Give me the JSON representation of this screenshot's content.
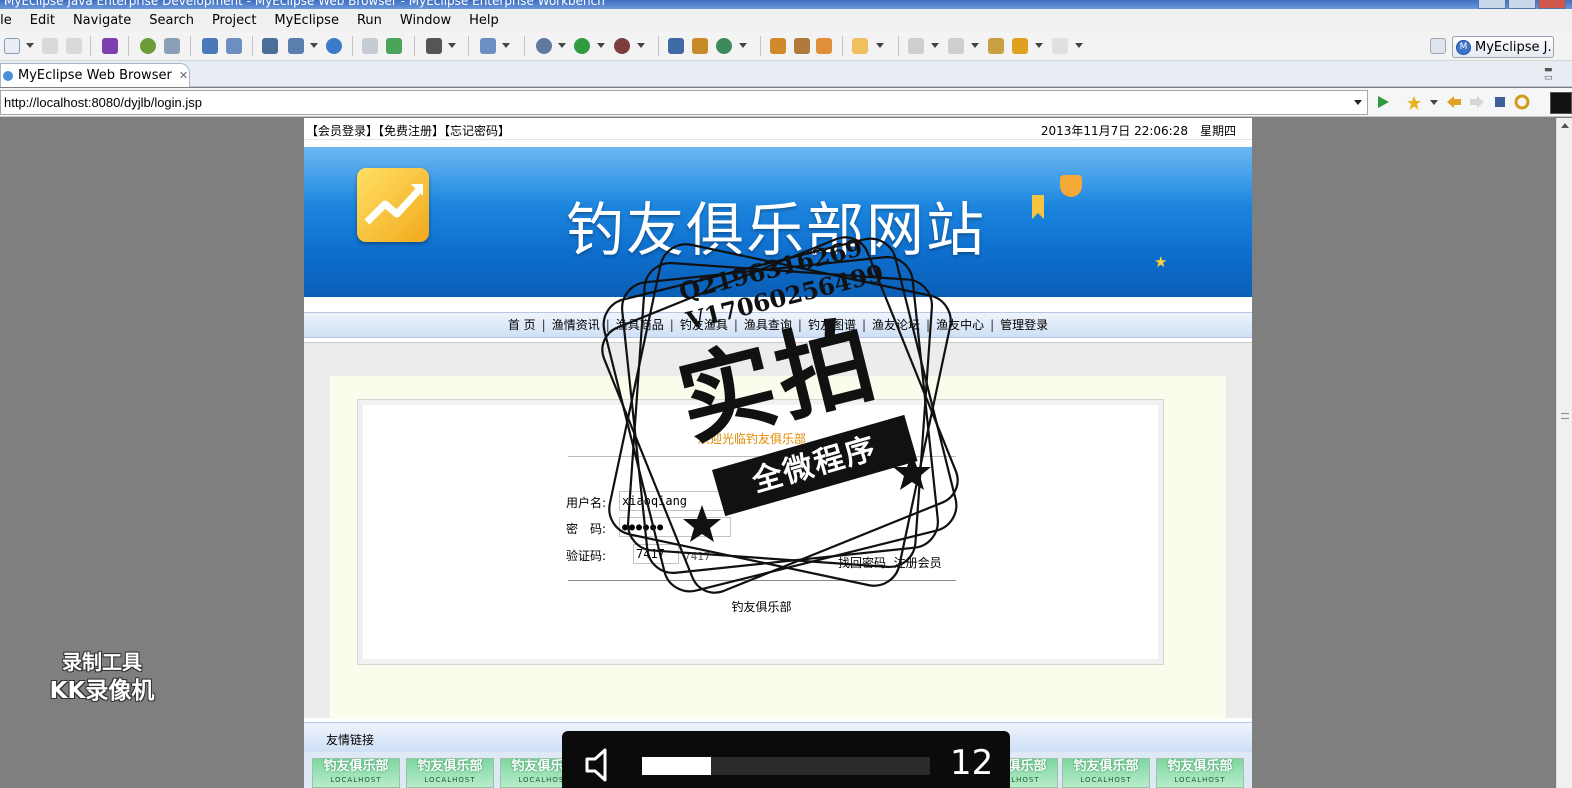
{
  "window": {
    "title": "MyEclipse Java Enterprise Development - MyEclipse Web Browser - MyEclipse Enterprise Workbench"
  },
  "menu": [
    "File",
    "Edit",
    "Navigate",
    "Search",
    "Project",
    "MyEclipse",
    "Run",
    "Window",
    "Help"
  ],
  "perspective": {
    "label": "MyEclipse J..."
  },
  "editor_tab": {
    "label": "MyEclipse Web Browser",
    "close": "✕"
  },
  "browser": {
    "url": "http://localhost:8080/dyjlb/login.jsp"
  },
  "site": {
    "top_links": [
      "【会员登录】",
      "【免费注册】",
      "【忘记密码】"
    ],
    "datetime": "2013年11月7日 22:06:28　星期四",
    "title": "钓友俱乐部网站",
    "nav": [
      "首 页",
      "渔情资讯",
      "渔具商品",
      "钓友渔具",
      "渔具查询",
      "钓友图谱",
      "渔友论坛",
      "渔友中心",
      "管理登录"
    ],
    "login": {
      "title": "欢迎光临钓友俱乐部",
      "username_label": "用户名:",
      "username_value": "xiaoqiang",
      "password_label": "密　码:",
      "password_value": "●●●●●●",
      "captcha_label": "验证码:",
      "captcha_value": "7417",
      "captcha_image": "7417",
      "forgot": "找回密码",
      "register": "注册会员",
      "footer": "钓友俱乐部"
    },
    "friend_links_title": "友情链接",
    "friend_logo": {
      "name": "钓友俱乐部",
      "sub": "LOCALHOST"
    }
  },
  "overlay": {
    "stamp_lines": [
      "Q2196316269",
      "V17060256499"
    ],
    "stamp_big": "实拍",
    "stamp_band": "全微程序",
    "watermark": [
      "录制工具",
      "KK录像机"
    ],
    "volume": {
      "level": 12,
      "fraction": 0.24
    }
  }
}
